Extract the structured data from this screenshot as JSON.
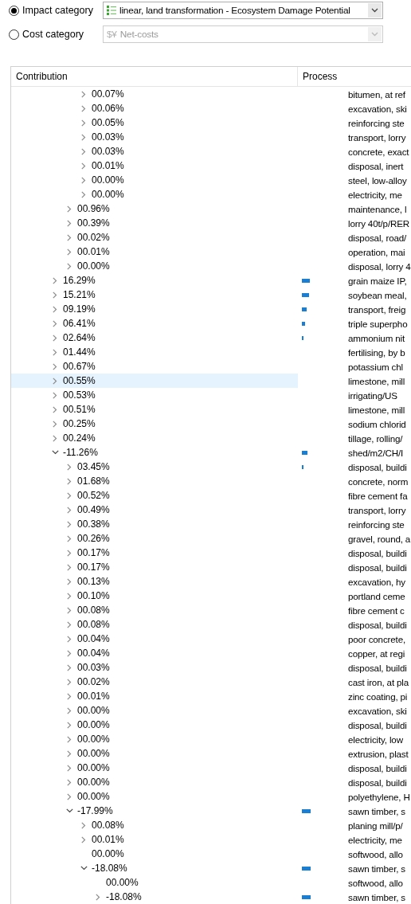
{
  "categories": [
    {
      "kind": "impact",
      "label": "Impact category",
      "selected": true,
      "value": "linear, land transformation - Ecosystem Damage Potential",
      "disabled": false
    },
    {
      "kind": "cost",
      "label": "Cost category",
      "selected": false,
      "icon": "$¥",
      "value": "Net-costs",
      "disabled": true
    }
  ],
  "table": {
    "columns": [
      "Contribution",
      "Process"
    ],
    "rows": [
      {
        "kind": "hidden",
        "children": [
          {
            "kind": "hidden",
            "children": [
              {
                "kind": "node",
                "contribution": "00.07%",
                "process": "bitumen, at ref",
                "expanded": false,
                "selected": false
              },
              {
                "kind": "node",
                "contribution": "00.06%",
                "process": "excavation, ski",
                "expanded": false,
                "selected": false
              },
              {
                "kind": "node",
                "contribution": "00.05%",
                "process": "reinforcing ste",
                "expanded": false,
                "selected": false
              },
              {
                "kind": "node",
                "contribution": "00.03%",
                "process": "transport, lorry",
                "expanded": false,
                "selected": false
              },
              {
                "kind": "node",
                "contribution": "00.03%",
                "process": "concrete, exact",
                "expanded": false,
                "selected": false
              },
              {
                "kind": "node",
                "contribution": "00.01%",
                "process": "disposal, inert",
                "expanded": false,
                "selected": false
              },
              {
                "kind": "node",
                "contribution": "00.00%",
                "process": "steel, low-alloy",
                "expanded": false,
                "selected": false
              },
              {
                "kind": "node",
                "contribution": "00.00%",
                "process": "electricity, me",
                "expanded": false,
                "selected": false
              }
            ]
          },
          {
            "kind": "node",
            "contribution": "00.96%",
            "process": "maintenance, l",
            "expanded": false,
            "selected": false
          },
          {
            "kind": "node",
            "contribution": "00.39%",
            "process": "lorry 40t/p/RER",
            "expanded": false,
            "selected": false
          },
          {
            "kind": "node",
            "contribution": "00.02%",
            "process": "disposal, road/",
            "expanded": false,
            "selected": false
          },
          {
            "kind": "node",
            "contribution": "00.01%",
            "process": "operation, mai",
            "expanded": false,
            "selected": false
          },
          {
            "kind": "node",
            "contribution": "00.00%",
            "process": "disposal, lorry 4",
            "expanded": false,
            "selected": false
          }
        ]
      },
      {
        "kind": "node",
        "contribution": "16.29%",
        "process": "grain maize IP,",
        "expanded": false,
        "selected": false,
        "bar": true
      },
      {
        "kind": "node",
        "contribution": "15.21%",
        "process": "soybean meal,",
        "expanded": false,
        "selected": false,
        "bar": true
      },
      {
        "kind": "node",
        "contribution": "09.19%",
        "process": "transport, freig",
        "expanded": false,
        "selected": false,
        "bar": true
      },
      {
        "kind": "node",
        "contribution": "06.41%",
        "process": "triple superpho",
        "expanded": false,
        "selected": false,
        "bar": true
      },
      {
        "kind": "node",
        "contribution": "02.64%",
        "process": "ammonium nit",
        "expanded": false,
        "selected": false,
        "bar": true
      },
      {
        "kind": "node",
        "contribution": "01.44%",
        "process": "fertilising, by b",
        "expanded": false,
        "selected": false
      },
      {
        "kind": "node",
        "contribution": "00.67%",
        "process": "potassium chl",
        "expanded": false,
        "selected": false
      },
      {
        "kind": "node",
        "contribution": "00.55%",
        "process": "limestone, mill",
        "expanded": false,
        "selected": true
      },
      {
        "kind": "node",
        "contribution": "00.53%",
        "process": "irrigating/US",
        "expanded": false,
        "selected": false
      },
      {
        "kind": "node",
        "contribution": "00.51%",
        "process": "limestone, mill",
        "expanded": false,
        "selected": false
      },
      {
        "kind": "node",
        "contribution": "00.25%",
        "process": "sodium chlorid",
        "expanded": false,
        "selected": false
      },
      {
        "kind": "node",
        "contribution": "00.24%",
        "process": "tillage, rolling/",
        "expanded": false,
        "selected": false
      },
      {
        "kind": "node",
        "contribution": "-11.26%",
        "process": "shed/m2/CH/I",
        "expanded": true,
        "selected": false,
        "bar": true,
        "children": [
          {
            "kind": "node",
            "contribution": "03.45%",
            "process": "disposal, buildi",
            "expanded": false,
            "selected": false,
            "bar": true
          },
          {
            "kind": "node",
            "contribution": "01.68%",
            "process": "concrete, norm",
            "expanded": false,
            "selected": false
          },
          {
            "kind": "node",
            "contribution": "00.52%",
            "process": "fibre cement fa",
            "expanded": false,
            "selected": false
          },
          {
            "kind": "node",
            "contribution": "00.49%",
            "process": "transport, lorry",
            "expanded": false,
            "selected": false
          },
          {
            "kind": "node",
            "contribution": "00.38%",
            "process": "reinforcing ste",
            "expanded": false,
            "selected": false
          },
          {
            "kind": "node",
            "contribution": "00.26%",
            "process": "gravel, round, a",
            "expanded": false,
            "selected": false
          },
          {
            "kind": "node",
            "contribution": "00.17%",
            "process": "disposal, buildi",
            "expanded": false,
            "selected": false
          },
          {
            "kind": "node",
            "contribution": "00.17%",
            "process": "disposal, buildi",
            "expanded": false,
            "selected": false
          },
          {
            "kind": "node",
            "contribution": "00.13%",
            "process": "excavation, hy",
            "expanded": false,
            "selected": false
          },
          {
            "kind": "node",
            "contribution": "00.10%",
            "process": "portland ceme",
            "expanded": false,
            "selected": false
          },
          {
            "kind": "node",
            "contribution": "00.08%",
            "process": "fibre cement c",
            "expanded": false,
            "selected": false
          },
          {
            "kind": "node",
            "contribution": "00.08%",
            "process": "disposal, buildi",
            "expanded": false,
            "selected": false
          },
          {
            "kind": "node",
            "contribution": "00.04%",
            "process": "poor concrete,",
            "expanded": false,
            "selected": false
          },
          {
            "kind": "node",
            "contribution": "00.04%",
            "process": "copper, at regi",
            "expanded": false,
            "selected": false
          },
          {
            "kind": "node",
            "contribution": "00.03%",
            "process": "disposal, buildi",
            "expanded": false,
            "selected": false
          },
          {
            "kind": "node",
            "contribution": "00.02%",
            "process": "cast iron, at pla",
            "expanded": false,
            "selected": false
          },
          {
            "kind": "node",
            "contribution": "00.01%",
            "process": "zinc coating, pi",
            "expanded": false,
            "selected": false
          },
          {
            "kind": "node",
            "contribution": "00.00%",
            "process": "excavation, ski",
            "expanded": false,
            "selected": false
          },
          {
            "kind": "node",
            "contribution": "00.00%",
            "process": "disposal, buildi",
            "expanded": false,
            "selected": false
          },
          {
            "kind": "node",
            "contribution": "00.00%",
            "process": "electricity, low",
            "expanded": false,
            "selected": false
          },
          {
            "kind": "node",
            "contribution": "00.00%",
            "process": "extrusion, plast",
            "expanded": false,
            "selected": false
          },
          {
            "kind": "node",
            "contribution": "00.00%",
            "process": "disposal, buildi",
            "expanded": false,
            "selected": false
          },
          {
            "kind": "node",
            "contribution": "00.00%",
            "process": "disposal, buildi",
            "expanded": false,
            "selected": false
          },
          {
            "kind": "node",
            "contribution": "00.00%",
            "process": "polyethylene, H",
            "expanded": false,
            "selected": false
          },
          {
            "kind": "node",
            "contribution": "-17.99%",
            "process": "sawn timber, s",
            "expanded": true,
            "selected": false,
            "bar": true,
            "children": [
              {
                "kind": "node",
                "contribution": "00.08%",
                "process": "planing mill/p/",
                "expanded": false,
                "selected": false
              },
              {
                "kind": "node",
                "contribution": "00.01%",
                "process": "electricity, me",
                "expanded": false,
                "selected": false
              },
              {
                "kind": "leaf",
                "contribution": "00.00%",
                "process": "softwood, allo",
                "selected": false
              },
              {
                "kind": "node",
                "contribution": "-18.08%",
                "process": "sawn timber, s",
                "expanded": true,
                "selected": false,
                "bar": true,
                "children": [
                  {
                    "kind": "leaf",
                    "contribution": "00.00%",
                    "process": "softwood, allo",
                    "selected": false
                  },
                  {
                    "kind": "node",
                    "contribution": "-18.08%",
                    "process": "sawn timber, s",
                    "expanded": false,
                    "selected": false,
                    "bar": true
                  }
                ]
              }
            ]
          }
        ]
      }
    ]
  }
}
